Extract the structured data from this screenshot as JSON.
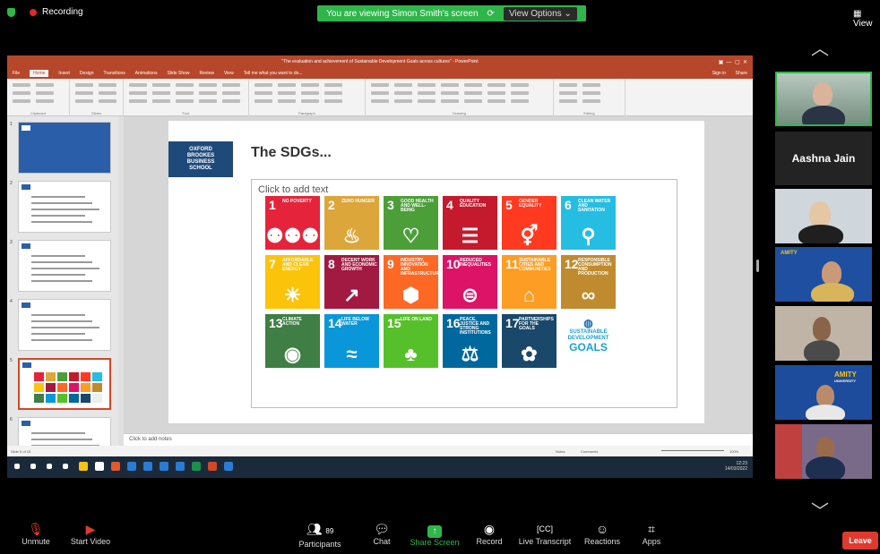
{
  "topbar": {
    "recording_label": "Recording",
    "viewing_banner": "You are viewing Simon Smith's screen",
    "view_options": "View Options",
    "view_button": "View"
  },
  "powerpoint": {
    "window_title": "\"The evaluation and achievement of Sustainable Development Goals across cultures\" - PowerPoint",
    "tabs": [
      "File",
      "Home",
      "Insert",
      "Design",
      "Transitions",
      "Animations",
      "Slide Show",
      "Review",
      "View",
      "Tell me what you want to do..."
    ],
    "active_tab": "Home",
    "signin": "Sign in",
    "share": "Share",
    "ribbon_groups": [
      "Clipboard",
      "Slides",
      "Font",
      "Paragraph",
      "Drawing",
      "Editing"
    ],
    "slide_title": "The SDGs...",
    "placeholder_text": "Click to add text",
    "logo_lines": [
      "OXFORD",
      "BROOKES",
      "BUSINESS",
      "SCHOOL"
    ],
    "notes_placeholder": "Click to add notes",
    "status_left": "Slide 5 of 15",
    "status_notes": "Notes",
    "status_comments": "Comments",
    "zoom": "100%",
    "clock_time": "12:23",
    "clock_date": "14/03/2022",
    "thumbnail_numbers": [
      "1",
      "2",
      "3",
      "4",
      "5",
      "6"
    ],
    "selected_slide": "5",
    "sdg_tiles": [
      {
        "num": "1",
        "label": "No poverty",
        "color": "#e5243b",
        "icon": "⚉⚉⚉"
      },
      {
        "num": "2",
        "label": "Zero hunger",
        "color": "#dda63a",
        "icon": "♨"
      },
      {
        "num": "3",
        "label": "Good health and well-being",
        "color": "#4c9f38",
        "icon": "♡"
      },
      {
        "num": "4",
        "label": "Quality education",
        "color": "#c5192d",
        "icon": "☰"
      },
      {
        "num": "5",
        "label": "Gender equality",
        "color": "#ff3a21",
        "icon": "⚥"
      },
      {
        "num": "6",
        "label": "Clean water and sanitation",
        "color": "#26bde2",
        "icon": "⚲"
      },
      {
        "num": "7",
        "label": "Affordable and clean energy",
        "color": "#fcc30b",
        "icon": "☀"
      },
      {
        "num": "8",
        "label": "Decent work and economic growth",
        "color": "#a21942",
        "icon": "↗"
      },
      {
        "num": "9",
        "label": "Industry, innovation and infrastructure",
        "color": "#fd6925",
        "icon": "⬢"
      },
      {
        "num": "10",
        "label": "Reduced inequalities",
        "color": "#dd1367",
        "icon": "⊜"
      },
      {
        "num": "11",
        "label": "Sustainable cities and communities",
        "color": "#fd9d24",
        "icon": "⌂"
      },
      {
        "num": "12",
        "label": "Responsible consumption and production",
        "color": "#bf8b2e",
        "icon": "∞"
      },
      {
        "num": "13",
        "label": "Climate action",
        "color": "#3f7e44",
        "icon": "◉"
      },
      {
        "num": "14",
        "label": "Life below water",
        "color": "#0a97d9",
        "icon": "≈"
      },
      {
        "num": "15",
        "label": "Life on land",
        "color": "#56c02b",
        "icon": "♣"
      },
      {
        "num": "16",
        "label": "Peace, justice and strong institutions",
        "color": "#00689d",
        "icon": "⚖"
      },
      {
        "num": "17",
        "label": "Partnerships for the goals",
        "color": "#19486a",
        "icon": "✿"
      }
    ],
    "sdg_logo": [
      "SUSTAINABLE",
      "DEVELOPMENT",
      "GOALS"
    ]
  },
  "participants": {
    "named_tile": "Aashna Jain",
    "amity_label": "AMITY",
    "amity_sub": "UNIVERSITY"
  },
  "toolbar": {
    "unmute": "Unmute",
    "start_video": "Start Video",
    "participants": "Participants",
    "participant_count": "89",
    "chat": "Chat",
    "share_screen": "Share Screen",
    "record": "Record",
    "live_transcript": "Live Transcript",
    "reactions": "Reactions",
    "apps": "Apps",
    "leave": "Leave"
  }
}
